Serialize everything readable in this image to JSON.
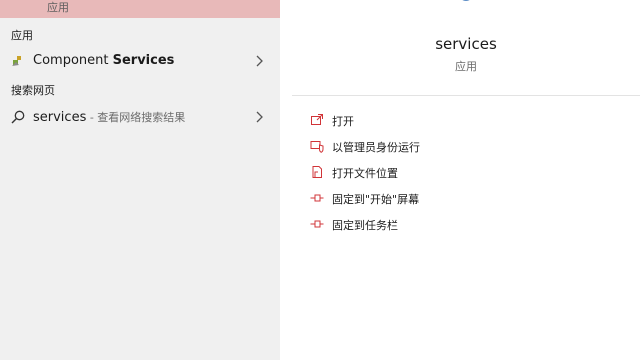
{
  "left_panel": {
    "top_item": {
      "subtitle": "应用"
    },
    "section_apps": "应用",
    "apps": [
      {
        "name_prefix": "Component ",
        "name_bold": "Services",
        "icon": "component-services-icon"
      }
    ],
    "section_web": "搜索网页",
    "web": [
      {
        "query": "services",
        "hint": " - 查看网络搜索结果",
        "icon": "search-icon"
      }
    ]
  },
  "right_panel": {
    "app_name": "services",
    "app_type": "应用",
    "actions": [
      {
        "label": "打开",
        "icon": "open-icon"
      },
      {
        "label": "以管理员身份运行",
        "icon": "run-as-admin-icon"
      },
      {
        "label": "打开文件位置",
        "icon": "file-location-icon"
      },
      {
        "label": "固定到\"开始\"屏幕",
        "icon": "pin-icon"
      },
      {
        "label": "固定到任务栏",
        "icon": "pin-icon"
      }
    ]
  },
  "colors": {
    "accent": "#d13438",
    "highlight": "#e8b9b9",
    "left_bg": "#f0f0f0"
  }
}
